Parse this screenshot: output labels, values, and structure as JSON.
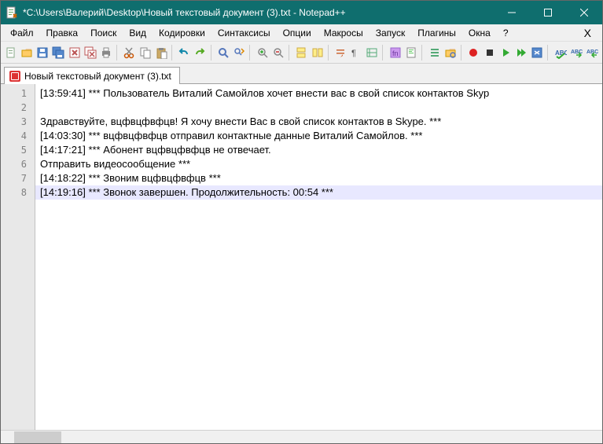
{
  "titlebar": {
    "title": "*C:\\Users\\Валерий\\Desktop\\Новый текстовый документ (3).txt - Notepad++"
  },
  "menu": {
    "items": [
      "Файл",
      "Правка",
      "Поиск",
      "Вид",
      "Кодировки",
      "Синтаксисы",
      "Опции",
      "Макросы",
      "Запуск",
      "Плагины",
      "Окна",
      "?"
    ],
    "extra": "X"
  },
  "toolbar": {
    "icons": [
      "new-file-icon",
      "open-file-icon",
      "save-icon",
      "save-all-icon",
      "close-icon",
      "close-all-icon",
      "print-icon",
      "sep",
      "cut-icon",
      "copy-icon",
      "paste-icon",
      "sep",
      "undo-icon",
      "redo-icon",
      "sep",
      "find-icon",
      "replace-icon",
      "sep",
      "zoom-in-icon",
      "zoom-out-icon",
      "sep",
      "sync-v-icon",
      "sync-h-icon",
      "sep",
      "wrap-icon",
      "all-chars-icon",
      "indent-guide-icon",
      "sep",
      "lang-icon",
      "doc-map-icon",
      "sep",
      "func-list-icon",
      "folder-icon",
      "sep",
      "record-icon",
      "stop-icon",
      "play-icon",
      "play-multi-icon",
      "save-macro-icon",
      "sep",
      "spell-icon",
      "spell-next-icon",
      "spell-prev-icon"
    ]
  },
  "tabs": [
    {
      "label": "Новый текстовый документ (3).txt",
      "dirty": true
    }
  ],
  "editor": {
    "lines": [
      "[13:59:41] *** Пользователь Виталий Самойлов хочет внести вас в свой список контактов Skyp",
      "",
      "Здравствуйте, вцфвцфвфцв! Я хочу внести Вас в свой список контактов в Skype. ***",
      "[14:03:30] *** вцфвцфвфцв отправил контактные данные Виталий Самойлов. ***",
      "[14:17:21] *** Абонент вцфвцфвфцв не отвечает.",
      "Отправить видеосообщение ***",
      "[14:18:22] *** Звоним вцфвцфвфцв ***",
      "[14:19:16] *** Звонок завершен. Продолжительность: 00:54 ***"
    ],
    "currentLine": 8
  }
}
